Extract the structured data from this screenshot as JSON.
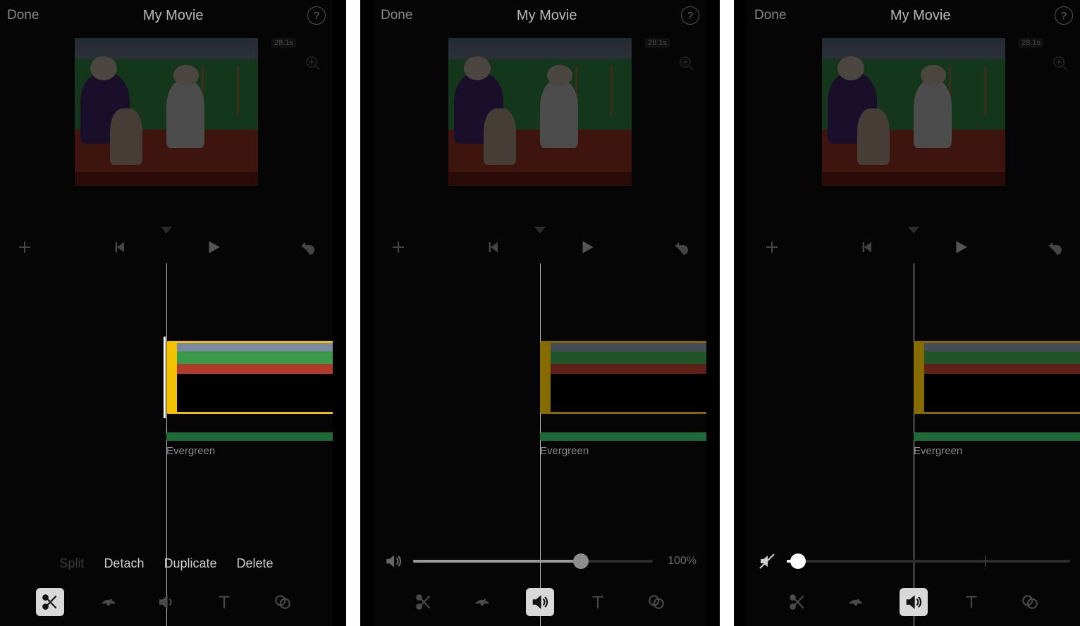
{
  "header": {
    "done": "Done",
    "title": "My Movie"
  },
  "preview": {
    "duration_badge": "28.1s"
  },
  "edit_actions": {
    "split": "Split",
    "detach": "Detach",
    "duplicate": "Duplicate",
    "delete": "Delete"
  },
  "audio": {
    "track_label": "Evergreen"
  },
  "volume": {
    "screen2_percent_label": "100%",
    "screen2_value": 70,
    "screen3_value": 4,
    "tick_at": 70
  },
  "tabs": [
    "scissors",
    "speed",
    "volume",
    "text",
    "filters"
  ]
}
